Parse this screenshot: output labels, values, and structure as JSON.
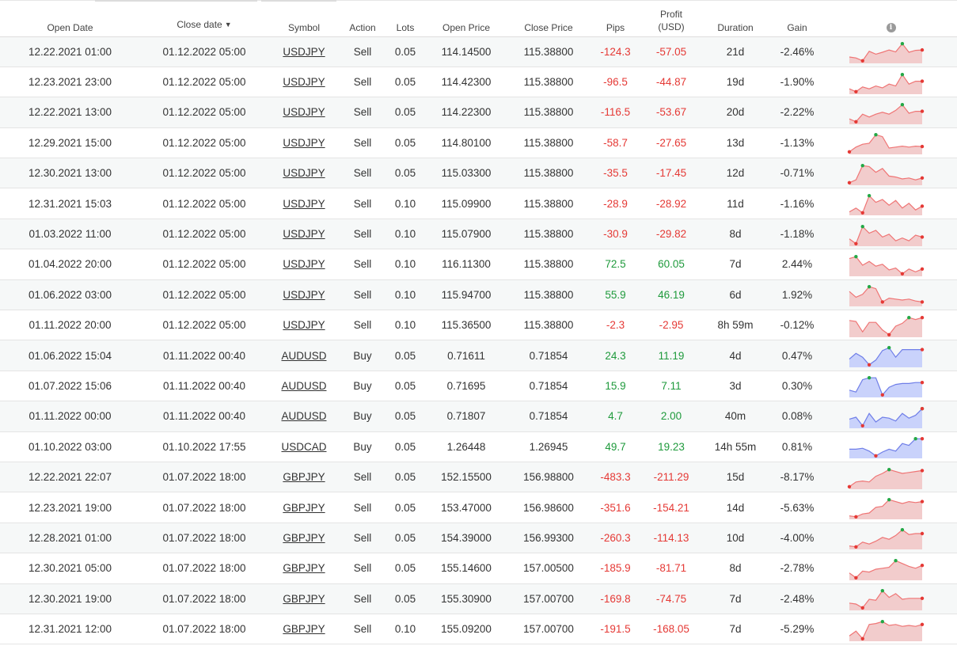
{
  "headers": {
    "open_date": "Open Date",
    "close_date": "Close date",
    "sort_indicator": "▼",
    "symbol": "Symbol",
    "action": "Action",
    "lots": "Lots",
    "open_price": "Open Price",
    "close_price": "Close Price",
    "pips": "Pips",
    "profit_line1": "Profit",
    "profit_line2": "(USD)",
    "duration": "Duration",
    "gain": "Gain",
    "info_glyph": "i"
  },
  "colors": {
    "negative_text": "#e53935",
    "positive_text": "#1f9a3c",
    "sell_line": "#ef7575",
    "sell_fill": "#f2cccc",
    "buy_line": "#6f7ee8",
    "buy_fill": "#c9d2fb",
    "max_dot": "#22a845",
    "min_dot": "#e53935"
  },
  "trades": [
    {
      "open": "12.22.2021 01:00",
      "close": "01.12.2022 05:00",
      "symbol": "USDJPY",
      "action": "Sell",
      "lots": "0.05",
      "open_price": "114.14500",
      "close_price": "115.38800",
      "pips": "-124.3",
      "profit": "-57.05",
      "duration": "21d",
      "gain": "-2.46%",
      "sign": "neg",
      "spark": [
        0.25,
        0.2,
        0.05,
        0.55,
        0.4,
        0.5,
        0.62,
        0.52,
        0.95,
        0.5,
        0.6,
        0.62
      ]
    },
    {
      "open": "12.23.2021 23:00",
      "close": "01.12.2022 05:00",
      "symbol": "USDJPY",
      "action": "Sell",
      "lots": "0.05",
      "open_price": "114.42300",
      "close_price": "115.38800",
      "pips": "-96.5",
      "profit": "-44.87",
      "duration": "19d",
      "gain": "-1.90%",
      "sign": "neg",
      "spark": [
        0.2,
        0.05,
        0.3,
        0.2,
        0.35,
        0.25,
        0.45,
        0.35,
        0.95,
        0.45,
        0.6,
        0.6
      ]
    },
    {
      "open": "12.22.2021 13:00",
      "close": "01.12.2022 05:00",
      "symbol": "USDJPY",
      "action": "Sell",
      "lots": "0.05",
      "open_price": "114.22300",
      "close_price": "115.38800",
      "pips": "-116.5",
      "profit": "-53.67",
      "duration": "20d",
      "gain": "-2.22%",
      "sign": "neg",
      "spark": [
        0.2,
        0.05,
        0.45,
        0.3,
        0.45,
        0.55,
        0.45,
        0.65,
        0.95,
        0.5,
        0.6,
        0.6
      ]
    },
    {
      "open": "12.29.2021 15:00",
      "close": "01.12.2022 05:00",
      "symbol": "USDJPY",
      "action": "Sell",
      "lots": "0.05",
      "open_price": "114.80100",
      "close_price": "115.38800",
      "pips": "-58.7",
      "profit": "-27.65",
      "duration": "13d",
      "gain": "-1.13%",
      "sign": "neg",
      "spark": [
        0.05,
        0.3,
        0.45,
        0.5,
        0.95,
        0.85,
        0.25,
        0.3,
        0.35,
        0.3,
        0.35,
        0.33
      ]
    },
    {
      "open": "12.30.2021 13:00",
      "close": "01.12.2022 05:00",
      "symbol": "USDJPY",
      "action": "Sell",
      "lots": "0.05",
      "open_price": "115.03300",
      "close_price": "115.38800",
      "pips": "-35.5",
      "profit": "-17.45",
      "duration": "12d",
      "gain": "-0.71%",
      "sign": "neg",
      "spark": [
        0.05,
        0.2,
        0.95,
        0.9,
        0.6,
        0.8,
        0.4,
        0.35,
        0.25,
        0.3,
        0.2,
        0.3
      ]
    },
    {
      "open": "12.31.2021 15:03",
      "close": "01.12.2022 05:00",
      "symbol": "USDJPY",
      "action": "Sell",
      "lots": "0.10",
      "open_price": "115.09900",
      "close_price": "115.38800",
      "pips": "-28.9",
      "profit": "-28.92",
      "duration": "11d",
      "gain": "-1.16%",
      "sign": "neg",
      "spark": [
        0.1,
        0.3,
        0.05,
        0.95,
        0.6,
        0.75,
        0.45,
        0.7,
        0.3,
        0.55,
        0.2,
        0.4
      ]
    },
    {
      "open": "01.03.2022 11:00",
      "close": "01.12.2022 05:00",
      "symbol": "USDJPY",
      "action": "Sell",
      "lots": "0.10",
      "open_price": "115.07900",
      "close_price": "115.38800",
      "pips": "-30.9",
      "profit": "-29.82",
      "duration": "8d",
      "gain": "-1.18%",
      "sign": "neg",
      "spark": [
        0.3,
        0.05,
        0.95,
        0.6,
        0.75,
        0.4,
        0.55,
        0.2,
        0.35,
        0.2,
        0.5,
        0.4
      ]
    },
    {
      "open": "01.04.2022 20:00",
      "close": "01.12.2022 05:00",
      "symbol": "USDJPY",
      "action": "Sell",
      "lots": "0.10",
      "open_price": "116.11300",
      "close_price": "115.38800",
      "pips": "72.5",
      "profit": "60.05",
      "duration": "7d",
      "gain": "2.44%",
      "sign": "pos",
      "spark": [
        0.85,
        0.95,
        0.5,
        0.7,
        0.45,
        0.55,
        0.25,
        0.35,
        0.05,
        0.3,
        0.15,
        0.3
      ]
    },
    {
      "open": "01.06.2022 03:00",
      "close": "01.12.2022 05:00",
      "symbol": "USDJPY",
      "action": "Sell",
      "lots": "0.10",
      "open_price": "115.94700",
      "close_price": "115.38800",
      "pips": "55.9",
      "profit": "46.19",
      "duration": "6d",
      "gain": "1.92%",
      "sign": "pos",
      "spark": [
        0.7,
        0.4,
        0.55,
        0.95,
        0.85,
        0.15,
        0.35,
        0.3,
        0.25,
        0.3,
        0.2,
        0.15
      ]
    },
    {
      "open": "01.11.2022 20:00",
      "close": "01.12.2022 05:00",
      "symbol": "USDJPY",
      "action": "Sell",
      "lots": "0.10",
      "open_price": "115.36500",
      "close_price": "115.38800",
      "pips": "-2.3",
      "profit": "-2.95",
      "duration": "8h 59m",
      "gain": "-0.12%",
      "sign": "neg",
      "spark": [
        0.8,
        0.75,
        0.2,
        0.7,
        0.7,
        0.3,
        0.05,
        0.5,
        0.65,
        0.95,
        0.85,
        0.95
      ]
    },
    {
      "open": "01.06.2022 15:04",
      "close": "01.11.2022 00:40",
      "symbol": "AUDUSD",
      "action": "Buy",
      "lots": "0.05",
      "open_price": "0.71611",
      "close_price": "0.71854",
      "pips": "24.3",
      "profit": "11.19",
      "duration": "4d",
      "gain": "0.47%",
      "sign": "pos",
      "spark": [
        0.35,
        0.65,
        0.45,
        0.05,
        0.3,
        0.8,
        0.95,
        0.45,
        0.85,
        0.85,
        0.85,
        0.85
      ]
    },
    {
      "open": "01.07.2022 15:06",
      "close": "01.11.2022 00:40",
      "symbol": "AUDUSD",
      "action": "Buy",
      "lots": "0.05",
      "open_price": "0.71695",
      "close_price": "0.71854",
      "pips": "15.9",
      "profit": "7.11",
      "duration": "3d",
      "gain": "0.30%",
      "sign": "pos",
      "spark": [
        0.3,
        0.2,
        0.85,
        0.95,
        0.95,
        0.05,
        0.45,
        0.6,
        0.65,
        0.65,
        0.7,
        0.7
      ]
    },
    {
      "open": "01.11.2022 00:00",
      "close": "01.11.2022 00:40",
      "symbol": "AUDUSD",
      "action": "Buy",
      "lots": "0.05",
      "open_price": "0.71807",
      "close_price": "0.71854",
      "pips": "4.7",
      "profit": "2.00",
      "duration": "40m",
      "gain": "0.08%",
      "sign": "pos",
      "spark": [
        0.4,
        0.5,
        0.05,
        0.7,
        0.25,
        0.5,
        0.45,
        0.3,
        0.7,
        0.45,
        0.6,
        0.95
      ]
    },
    {
      "open": "01.10.2022 03:00",
      "close": "01.10.2022 17:55",
      "symbol": "USDCAD",
      "action": "Buy",
      "lots": "0.05",
      "open_price": "1.26448",
      "close_price": "1.26945",
      "pips": "49.7",
      "profit": "19.23",
      "duration": "14h 55m",
      "gain": "0.81%",
      "sign": "pos",
      "spark": [
        0.4,
        0.4,
        0.45,
        0.3,
        0.05,
        0.25,
        0.4,
        0.3,
        0.7,
        0.6,
        0.95,
        0.95
      ]
    },
    {
      "open": "12.22.2021 22:07",
      "close": "01.07.2022 18:00",
      "symbol": "GBPJPY",
      "action": "Sell",
      "lots": "0.05",
      "open_price": "152.15500",
      "close_price": "156.98800",
      "pips": "-483.3",
      "profit": "-211.29",
      "duration": "15d",
      "gain": "-8.17%",
      "sign": "neg",
      "spark": [
        0.05,
        0.3,
        0.35,
        0.3,
        0.6,
        0.75,
        0.95,
        0.85,
        0.75,
        0.8,
        0.85,
        0.9
      ]
    },
    {
      "open": "12.23.2021 19:00",
      "close": "01.07.2022 18:00",
      "symbol": "GBPJPY",
      "action": "Sell",
      "lots": "0.05",
      "open_price": "153.47000",
      "close_price": "156.98600",
      "pips": "-351.6",
      "profit": "-154.21",
      "duration": "14d",
      "gain": "-5.63%",
      "sign": "neg",
      "spark": [
        0.1,
        0.05,
        0.2,
        0.25,
        0.55,
        0.6,
        0.95,
        0.85,
        0.75,
        0.85,
        0.8,
        0.85
      ]
    },
    {
      "open": "12.28.2021 01:00",
      "close": "01.07.2022 18:00",
      "symbol": "GBPJPY",
      "action": "Sell",
      "lots": "0.05",
      "open_price": "154.39000",
      "close_price": "156.99300",
      "pips": "-260.3",
      "profit": "-114.13",
      "duration": "10d",
      "gain": "-4.00%",
      "sign": "neg",
      "spark": [
        0.1,
        0.05,
        0.3,
        0.2,
        0.35,
        0.55,
        0.45,
        0.65,
        0.95,
        0.7,
        0.75,
        0.75
      ]
    },
    {
      "open": "12.30.2021 05:00",
      "close": "01.07.2022 18:00",
      "symbol": "GBPJPY",
      "action": "Sell",
      "lots": "0.05",
      "open_price": "155.14600",
      "close_price": "157.00500",
      "pips": "-185.9",
      "profit": "-81.71",
      "duration": "8d",
      "gain": "-2.78%",
      "sign": "neg",
      "spark": [
        0.3,
        0.05,
        0.4,
        0.35,
        0.5,
        0.55,
        0.6,
        0.95,
        0.8,
        0.65,
        0.55,
        0.7
      ]
    },
    {
      "open": "12.30.2021 19:00",
      "close": "01.07.2022 18:00",
      "symbol": "GBPJPY",
      "action": "Sell",
      "lots": "0.05",
      "open_price": "155.30900",
      "close_price": "157.00700",
      "pips": "-169.8",
      "profit": "-74.75",
      "duration": "7d",
      "gain": "-2.48%",
      "sign": "neg",
      "spark": [
        0.3,
        0.25,
        0.05,
        0.5,
        0.45,
        0.95,
        0.6,
        0.8,
        0.5,
        0.55,
        0.55,
        0.55
      ]
    },
    {
      "open": "12.31.2021 12:00",
      "close": "01.07.2022 18:00",
      "symbol": "GBPJPY",
      "action": "Sell",
      "lots": "0.10",
      "open_price": "155.09200",
      "close_price": "157.00700",
      "pips": "-191.5",
      "profit": "-168.05",
      "duration": "7d",
      "gain": "-5.29%",
      "sign": "neg",
      "spark": [
        0.2,
        0.45,
        0.05,
        0.8,
        0.85,
        0.95,
        0.75,
        0.8,
        0.7,
        0.75,
        0.7,
        0.8
      ]
    }
  ]
}
